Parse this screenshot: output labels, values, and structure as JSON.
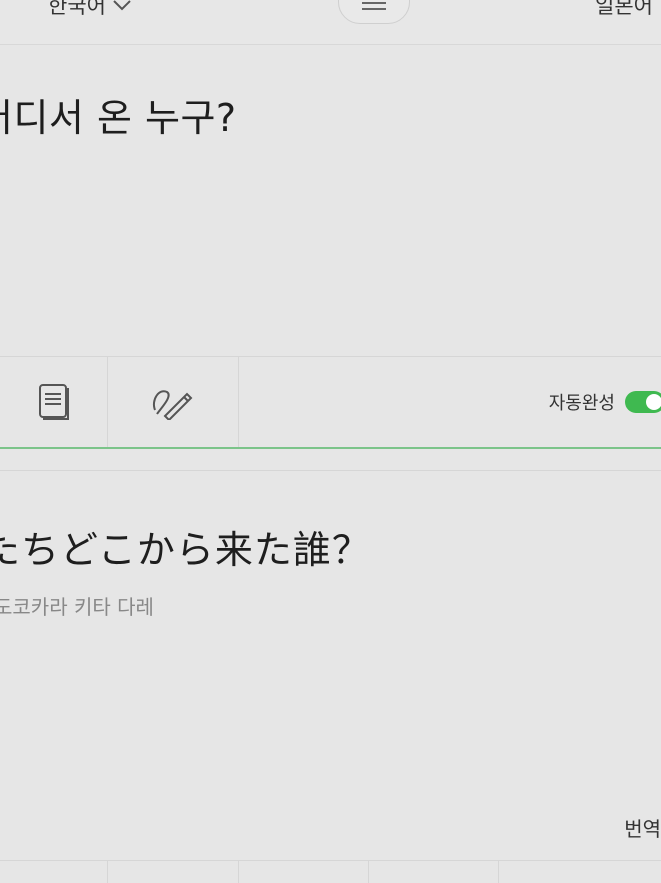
{
  "header": {
    "source_language": "한국어",
    "target_language": "일본어",
    "swap_icon": "swap-arrows-icon",
    "dropdown_icon": "chevron-down-icon"
  },
  "source": {
    "text": "어디서 온 누구?"
  },
  "toolbar": {
    "icons": [
      "document-icon",
      "handwriting-icon"
    ],
    "autocomplete_label": "자동완성",
    "autocomplete_on": true,
    "accent_color": "#3fb950"
  },
  "result": {
    "text": "たちどこから来た誰？",
    "pronunciation": "도코카라 키타 다레",
    "translate_label": "번역"
  }
}
